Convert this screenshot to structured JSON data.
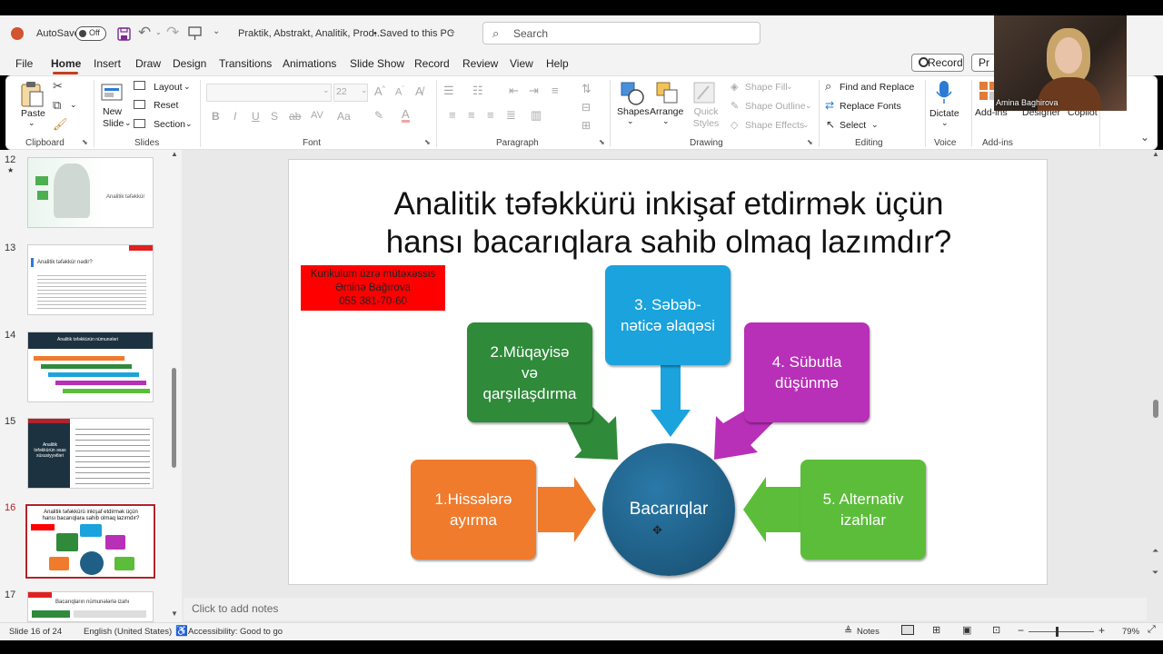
{
  "titlebar": {
    "autosave_label": "AutoSave",
    "autosave_state": "Off",
    "doc_title": "Praktik, Abstrakt, Analitik, Prod...",
    "save_state": "• Saved to this PC",
    "search_placeholder": "Search"
  },
  "tabs": [
    "File",
    "Home",
    "Insert",
    "Draw",
    "Design",
    "Transitions",
    "Animations",
    "Slide Show",
    "Record",
    "Review",
    "View",
    "Help"
  ],
  "active_tab": "Home",
  "record_button": "Record",
  "present_button": "Pr",
  "ribbon": {
    "clipboard": {
      "paste": "Paste",
      "label": "Clipboard"
    },
    "slides": {
      "new_slide": "New Slide",
      "layout": "Layout",
      "reset": "Reset",
      "section": "Section",
      "label": "Slides"
    },
    "font": {
      "size": "22",
      "label": "Font"
    },
    "paragraph": {
      "label": "Paragraph"
    },
    "drawing": {
      "shapes": "Shapes",
      "arrange": "Arrange",
      "quick_styles": "Quick Styles",
      "shape_fill": "Shape Fill",
      "shape_outline": "Shape Outline",
      "shape_effects": "Shape Effects",
      "label": "Drawing"
    },
    "editing": {
      "find_replace": "Find and Replace",
      "replace_fonts": "Replace Fonts",
      "select": "Select",
      "label": "Editing"
    },
    "voice": {
      "dictate": "Dictate",
      "label": "Voice"
    },
    "addins": {
      "addins": "Add-ins",
      "designer": "Designer",
      "copilot": "Copilot",
      "label": "Add-ins"
    }
  },
  "webcam": {
    "name": "Amina Baghirova"
  },
  "thumbnails": [
    {
      "num": "12",
      "star": "★",
      "title": "Analitik təfəkkür"
    },
    {
      "num": "13",
      "title": "Analitik təfəkkür nədir?"
    },
    {
      "num": "14",
      "title": "Analitik təfəkkürün nümunələri"
    },
    {
      "num": "15",
      "title": "Analitik təfəkkürün əsas xüsusiyyətləri"
    },
    {
      "num": "16",
      "title": "Analitik təfəkkürü inkişaf etdirmək üçün hansı bacarıqlara sahib olmaq lazımdır?"
    },
    {
      "num": "17",
      "title": "Bacarıqların nümunələrlə izahı"
    }
  ],
  "slide": {
    "title_line1": "Analitik təfəkkürü inkişaf etdirmək üçün",
    "title_line2": "hansı bacarıqlara sahib olmaq lazımdır?",
    "author_line1": "Kurikulum üzrə mütəxəssis",
    "author_line2": "Əminə Bağırova",
    "author_line3": "055 381-70-60",
    "center": "Bacarıqlar",
    "skill1": "1.Hissələrə ayırma",
    "skill2_l1": "2.Müqayisə",
    "skill2_l2": "və",
    "skill2_l3": "qarşılaşdırma",
    "skill3_l1": "3. Səbəb-",
    "skill3_l2": "nəticə əlaqəsi",
    "skill4_l1": "4. Sübutla",
    "skill4_l2": "düşünmə",
    "skill5_l1": "5. Alternativ",
    "skill5_l2": "izahlar",
    "colors": {
      "orange": "#f07b2c",
      "green": "#2f8a3a",
      "blue": "#1aa3dc",
      "purple": "#b82fb8",
      "lightgreen": "#5cbd3a",
      "circle": "#1f5f86",
      "red": "#ff0000"
    }
  },
  "notes_placeholder": "Click to add notes",
  "status": {
    "slide_info": "Slide 16 of 24",
    "language": "English (United States)",
    "accessibility": "Accessibility: Good to go",
    "notes": "Notes",
    "zoom": "79%"
  }
}
